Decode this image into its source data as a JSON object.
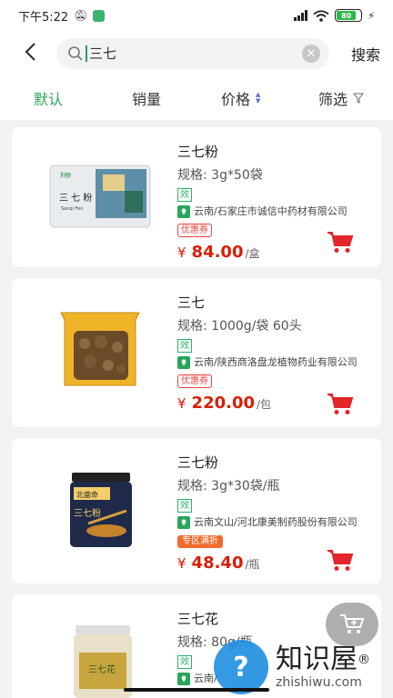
{
  "status": {
    "time": "下午5:22",
    "battery": "80"
  },
  "search": {
    "back_icon": "chevron-left-icon",
    "value": "三七",
    "button": "搜索"
  },
  "sort": {
    "default": "默认",
    "sales": "销量",
    "price": "价格",
    "filter": "筛选"
  },
  "accent_color": "#2aa65b",
  "price_color": "#d81e06",
  "products": [
    {
      "name": "三七粉",
      "spec": "规格: 3g*50袋",
      "pay_tag": "效",
      "origin": "云南/石家庄市诚信中药材有限公司",
      "badge": "优惠券",
      "currency": "¥",
      "price": "84.00",
      "unit": "/盒",
      "box_title": "三 七 粉",
      "box_sub": "Sanqi Fen"
    },
    {
      "name": "三七",
      "spec": "规格: 1000g/袋 60头",
      "pay_tag": "效",
      "origin": "云南/陕西商洛盘龙植物药业有限公司",
      "badge": "优惠券",
      "currency": "¥",
      "price": "220.00",
      "unit": "/包"
    },
    {
      "name": "三七粉",
      "spec": "规格: 3g*30袋/瓶",
      "pay_tag": "效",
      "origin": "云南文山/河北康美制药股份有限公司",
      "badge": "专区满折",
      "currency": "¥",
      "price": "48.40",
      "unit": "/瓶",
      "jar_label": "三七粉"
    },
    {
      "name": "三七花",
      "spec": "规格: 80g/瓶",
      "pay_tag": "效",
      "origin": "云南/",
      "jar_label": "三七花"
    }
  ],
  "watermark": {
    "cn": "知识屋",
    "en": "zhishiwu.com"
  }
}
